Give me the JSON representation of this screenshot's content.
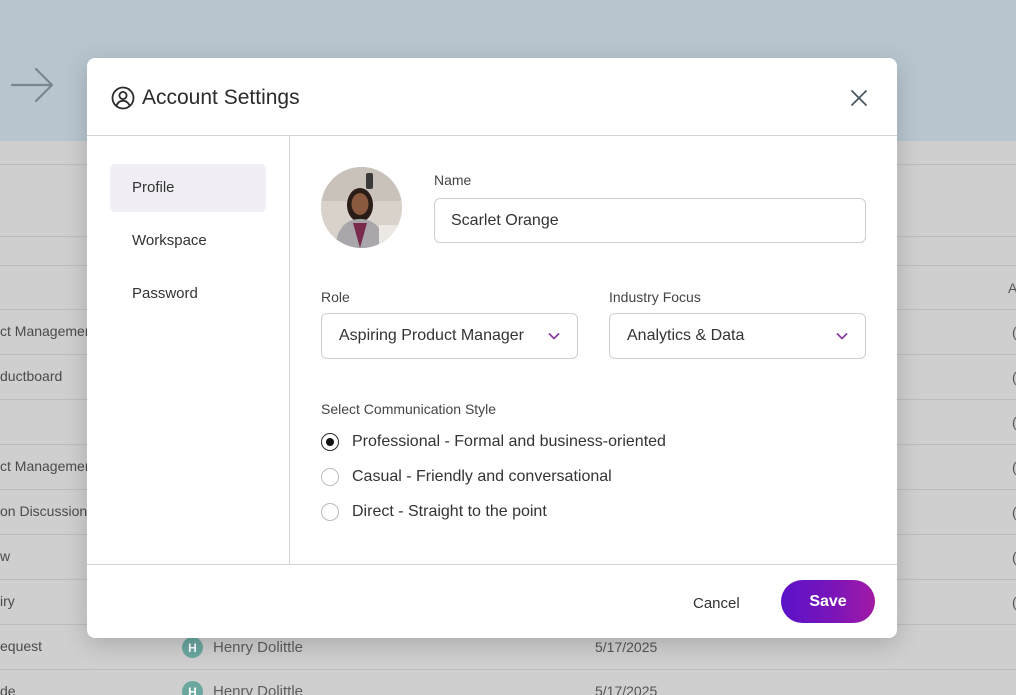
{
  "modal": {
    "title": "Account Settings",
    "nav": [
      "Profile",
      "Workspace",
      "Password"
    ],
    "active_nav": "Profile",
    "name_label": "Name",
    "name_value": "Scarlet Orange",
    "role_label": "Role",
    "role_value": "Aspiring Product Manager",
    "industry_label": "Industry Focus",
    "industry_value": "Analytics & Data",
    "comm_label": "Select Communication Style",
    "comm_options": [
      "Professional - Formal and business-oriented",
      "Casual - Friendly and conversational",
      "Direct - Straight to the point"
    ],
    "comm_selected": "Professional - Formal and business-oriented",
    "cancel_label": "Cancel",
    "save_label": "Save"
  },
  "background": {
    "rows": [
      "ct Managemer",
      "ductboard",
      "ct Managemer",
      "on Discussion",
      "w",
      "iry",
      "equest",
      "de"
    ],
    "header_fragment": "A",
    "people": [
      {
        "initial": "H",
        "name": "Henry Dolittle",
        "date": "5/17/2025"
      },
      {
        "initial": "H",
        "name": "Henry Dolittle",
        "date": "5/17/2025"
      }
    ]
  },
  "colors": {
    "accent_start": "#5b12c9",
    "accent_end": "#a21aa6",
    "top_banner": "#b8c5cf"
  },
  "icons": [
    "arrow-right-icon",
    "user-circle-icon",
    "close-icon",
    "chevron-down-icon"
  ]
}
